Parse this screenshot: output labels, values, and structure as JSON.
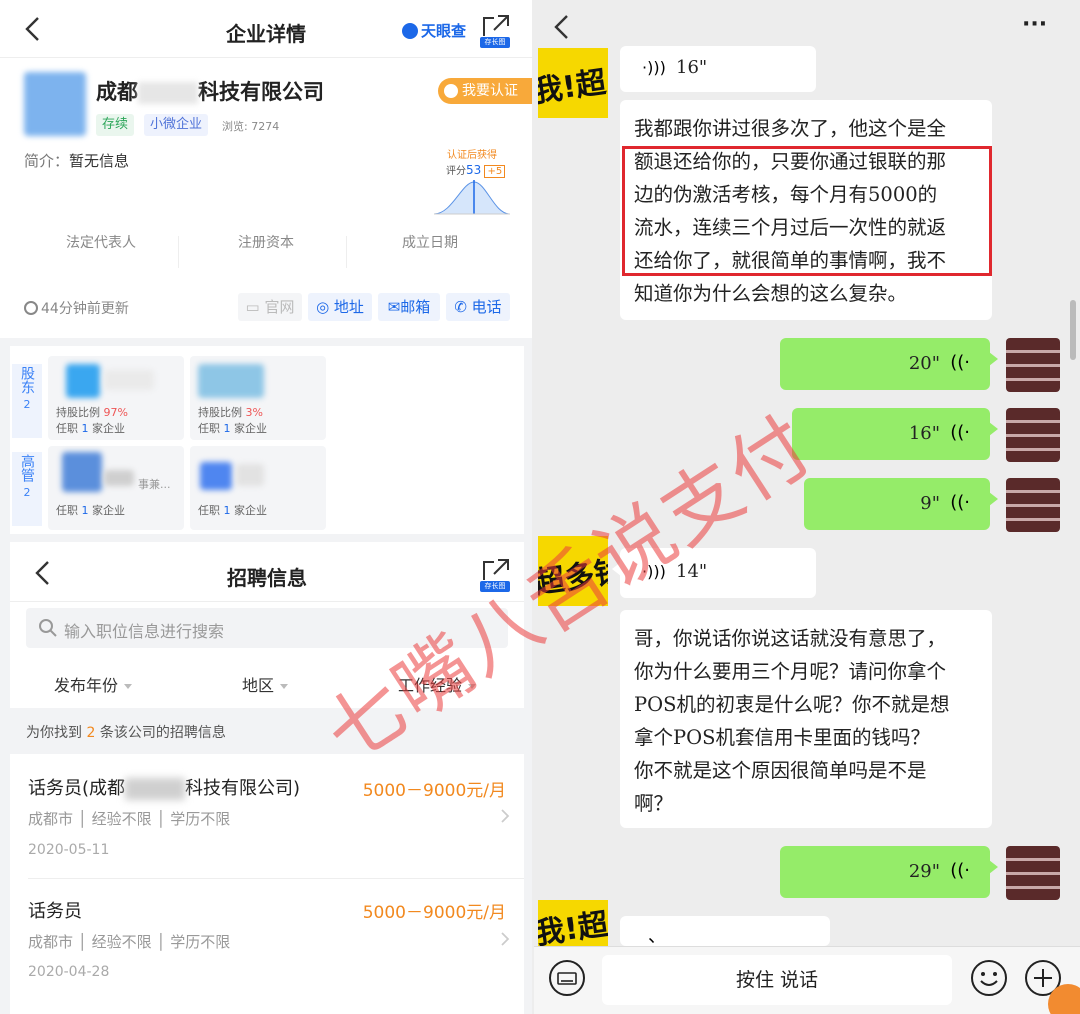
{
  "left": {
    "company_page": {
      "title": "企业详情",
      "brand": "天眼查",
      "share_badge": "存长图",
      "company_name_prefix": "成都",
      "company_name_suffix": "科技有限公司",
      "certify_button": "我要认证",
      "tag_status": "存续",
      "tag_size": "小微企业",
      "views": "浏览: 7274",
      "intro_label": "简介：",
      "intro_value": "暂无信息",
      "score_chart_title": "认证后获得",
      "score_label": "评分",
      "score_value": "53",
      "score_gain": "+5",
      "stats": [
        "法定代表人",
        "注册资本",
        "成立日期"
      ],
      "updated": "44分钟前更新",
      "contact_links": [
        "官网",
        "地址",
        "邮箱",
        "电话"
      ],
      "shareholder_label": "股东",
      "shareholder_count": "2",
      "manager_label": "高管",
      "manager_count": "2",
      "shareholders": [
        {
          "share_label": "持股比例",
          "share_value": "97%",
          "role_prefix": "任职",
          "role_count": "1",
          "role_suffix": "家企业"
        },
        {
          "share_label": "持股比例",
          "share_value": "3%",
          "role_prefix": "任职",
          "role_count": "1",
          "role_suffix": "家企业"
        }
      ],
      "managers": [
        {
          "title_partial": "事兼...",
          "role_prefix": "任职",
          "role_count": "1",
          "role_suffix": "家企业"
        },
        {
          "role_prefix": "任职",
          "role_count": "1",
          "role_suffix": "家企业"
        }
      ]
    },
    "jobs_page": {
      "title": "招聘信息",
      "share_badge": "存长图",
      "search_placeholder": "输入职位信息进行搜索",
      "filters": [
        "发布年份",
        "地区",
        "工作经验"
      ],
      "result_prefix": "为你找到",
      "result_count": "2",
      "result_suffix": "条该公司的招聘信息",
      "jobs": [
        {
          "title_prefix": "话务员(成都",
          "title_suffix": "科技有限公司)",
          "salary": "5000－9000元/月",
          "city": "成都市",
          "experience": "经验不限",
          "education": "学历不限",
          "date": "2020-05-11"
        },
        {
          "title_prefix": "话务员",
          "title_suffix": "",
          "salary": "5000－9000元/月",
          "city": "成都市",
          "experience": "经验不限",
          "education": "学历不限",
          "date": "2020-04-28"
        }
      ]
    }
  },
  "right": {
    "more": "···",
    "msg_voice_1": "16\"",
    "msg_text_1": [
      "我都跟你讲过很多次了，他这个是全",
      "额退还给你的，只要你通过银联的那",
      "边的伪激活考核，每个月有5000的",
      "流水，连续三个月过后一次性的就返",
      "还给你了，就很简单的事情啊，我不",
      "知道你为什么会想的这么复杂。"
    ],
    "my_voice": [
      "20\"",
      "16\"",
      "9\""
    ],
    "msg_voice_2": "14\"",
    "msg_text_2": [
      "哥，你说话你说这话就没有意思了，",
      "你为什么要用三个月呢？请问你拿个",
      "POS机的初衷是什么呢？你不就是想",
      "拿个POS机套信用卡里面的钱吗？",
      "你不就是这个原因很简单吗是不是",
      "啊？"
    ],
    "my_voice_last": "29\"",
    "partial_msg": "、",
    "avatar_text_1": "我!超",
    "avatar_text_2": "超多钱",
    "avatar_text_3": "我!超",
    "hold_to_talk": "按住 说话"
  },
  "watermark": "七嘴八舌说支付",
  "colors": {
    "accent_blue": "#1c68e8",
    "salary_orange": "#f2891f",
    "wechat_green": "#95ec69",
    "highlight_red": "#e0282e",
    "watermark": "#eb3c3c"
  }
}
